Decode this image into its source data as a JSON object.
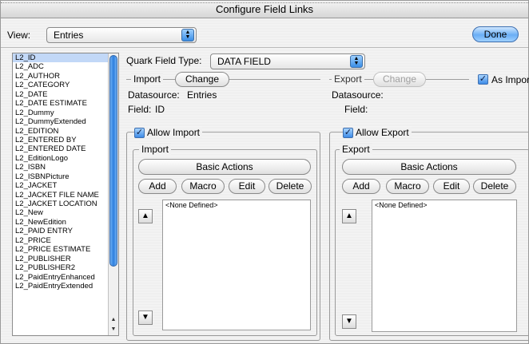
{
  "window": {
    "title": "Configure Field Links"
  },
  "toolbar": {
    "view_label": "View:",
    "view_value": "Entries",
    "done_label": "Done"
  },
  "field_list": {
    "items": [
      "L2_ID",
      "L2_ADC",
      "L2_AUTHOR",
      "L2_CATEGORY",
      "L2_DATE",
      "L2_DATE ESTIMATE",
      "L2_Dummy",
      "L2_DummyExtended",
      "L2_EDITION",
      "L2_ENTERED BY",
      "L2_ENTERED DATE",
      "L2_EditionLogo",
      "L2_ISBN",
      "L2_ISBNPicture",
      "L2_JACKET",
      "L2_JACKET FILE NAME",
      "L2_JACKET LOCATION",
      "L2_New",
      "L2_NewEdition",
      "L2_PAID ENTRY",
      "L2_PRICE",
      "L2_PRICE ESTIMATE",
      "L2_PUBLISHER",
      "L2_PUBLISHER2",
      "L2_PaidEntryEnhanced",
      "L2_PaidEntryExtended"
    ],
    "selected_index": 0
  },
  "field_type": {
    "label": "Quark Field Type:",
    "value": "DATA FIELD"
  },
  "import_source": {
    "legend": "Import",
    "change_label": "Change",
    "datasource_label": "Datasource:",
    "datasource_value": "Entries",
    "field_label": "Field:",
    "field_value": "ID"
  },
  "export_source": {
    "legend": "Export",
    "change_label": "Change",
    "as_import_label": "As Import",
    "datasource_label": "Datasource:",
    "datasource_value": "",
    "field_label": "Field:",
    "field_value": ""
  },
  "allow_import": {
    "checkbox_label": "Allow Import",
    "group_legend": "Import",
    "basic_actions_label": "Basic Actions",
    "add_label": "Add",
    "macro_label": "Macro",
    "edit_label": "Edit",
    "delete_label": "Delete",
    "list_placeholder": "<None Defined>"
  },
  "allow_export": {
    "checkbox_label": "Allow Export",
    "group_legend": "Export",
    "basic_actions_label": "Basic Actions",
    "add_label": "Add",
    "macro_label": "Macro",
    "edit_label": "Edit",
    "delete_label": "Delete",
    "list_placeholder": "<None Defined>"
  },
  "icons": {
    "up": "arrow-up-icon",
    "down": "arrow-down-icon",
    "check": "checkmark-icon",
    "popup": "popup-arrows-icon"
  },
  "colors": {
    "accent": "#3d8be6",
    "selection": "#c2d8f7"
  }
}
